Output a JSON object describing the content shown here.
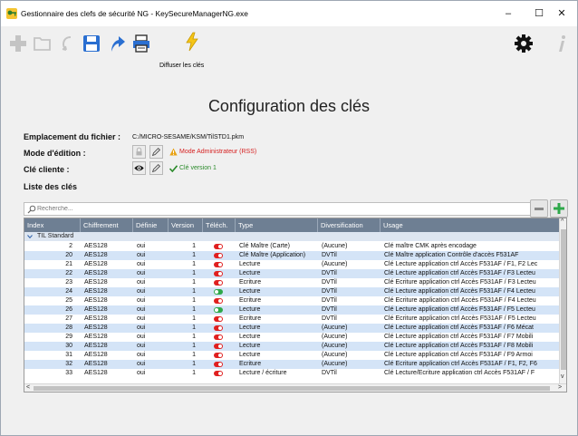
{
  "window": {
    "title": "Gestionnaire des clefs de sécurité NG - KeySecureManagerNG.exe",
    "controls": {
      "minimize": "–",
      "maximize": "☐",
      "close": "✕"
    }
  },
  "toolbar": {
    "icons": [
      "add-icon",
      "folder-open-icon",
      "undo-icon",
      "save-icon",
      "upload-icon",
      "printer-icon",
      "lightning-icon",
      "gear-icon",
      "info-icon"
    ],
    "broadcast_label": "Diffuser les clés"
  },
  "page": {
    "title": "Configuration des clés",
    "file_location_label": "Emplacement du fichier :",
    "file_location_value": "C:/MICRO-SESAME/KSM/TilSTD1.pkm",
    "edit_mode_label": "Mode d'édition :",
    "edit_mode_status": "Mode Administrateur (RSS)",
    "client_key_label": "Clé cliente :",
    "client_key_status": "Clé version 1",
    "key_list_label": "Liste des clés"
  },
  "search": {
    "placeholder": "Recherche..."
  },
  "list_buttons": {
    "remove": "−",
    "add": "+"
  },
  "colors": {
    "header_bg": "#6e7f93",
    "row_alt": "#d4e4f7",
    "toggle_off": "#e02020",
    "toggle_on": "#2ea84a",
    "warning": "#d62222",
    "ok": "#2a8a2a"
  },
  "grid": {
    "columns": [
      "Index",
      "Chiffrement",
      "Définie",
      "Version",
      "Téléch.",
      "Type",
      "Diversification",
      "Usage"
    ],
    "group": "TIL Standard",
    "rows": [
      {
        "index": "2",
        "cipher": "AES128",
        "defined": "oui",
        "version": "1",
        "download": false,
        "type": "Clé Maître (Carte)",
        "div": "(Aucune)",
        "usage": "Clé maître CMK après encodage"
      },
      {
        "index": "20",
        "cipher": "AES128",
        "defined": "oui",
        "version": "1",
        "download": false,
        "type": "Clé Maître (Application)",
        "div": "DVTil",
        "usage": "Clé Maître application Contrôle d'accès F531AF"
      },
      {
        "index": "21",
        "cipher": "AES128",
        "defined": "oui",
        "version": "1",
        "download": false,
        "type": "Lecture",
        "div": "(Aucune)",
        "usage": "Clé Lecture application ctrl Accès F531AF / F1, F2 Lec"
      },
      {
        "index": "22",
        "cipher": "AES128",
        "defined": "oui",
        "version": "1",
        "download": false,
        "type": "Lecture",
        "div": "DVTil",
        "usage": "Clé Lecture application ctrl Accès F531AF / F3 Lecteu"
      },
      {
        "index": "23",
        "cipher": "AES128",
        "defined": "oui",
        "version": "1",
        "download": false,
        "type": "Ecriture",
        "div": "DVTil",
        "usage": "Clé Ecriture application ctrl Accès F531AF / F3 Lecteu"
      },
      {
        "index": "24",
        "cipher": "AES128",
        "defined": "oui",
        "version": "1",
        "download": true,
        "type": "Lecture",
        "div": "DVTil",
        "usage": "Clé Lecture application ctrl Accès F531AF / F4 Lecteu"
      },
      {
        "index": "25",
        "cipher": "AES128",
        "defined": "oui",
        "version": "1",
        "download": false,
        "type": "Ecriture",
        "div": "DVTil",
        "usage": "Clé Ecriture application ctrl Accès F531AF / F4 Lecteu"
      },
      {
        "index": "26",
        "cipher": "AES128",
        "defined": "oui",
        "version": "1",
        "download": true,
        "type": "Lecture",
        "div": "DVTil",
        "usage": "Clé Lecture application ctrl Accès F531AF / F5 Lecteu"
      },
      {
        "index": "27",
        "cipher": "AES128",
        "defined": "oui",
        "version": "1",
        "download": false,
        "type": "Ecriture",
        "div": "DVTil",
        "usage": "Clé Ecriture application ctrl Accès F531AF / F5 Lecteu"
      },
      {
        "index": "28",
        "cipher": "AES128",
        "defined": "oui",
        "version": "1",
        "download": false,
        "type": "Lecture",
        "div": "(Aucune)",
        "usage": "Clé Lecture application ctrl Accès F531AF / F6 Mécat"
      },
      {
        "index": "29",
        "cipher": "AES128",
        "defined": "oui",
        "version": "1",
        "download": false,
        "type": "Lecture",
        "div": "(Aucune)",
        "usage": "Clé Lecture application ctrl Accès F531AF / F7 Mobili"
      },
      {
        "index": "30",
        "cipher": "AES128",
        "defined": "oui",
        "version": "1",
        "download": false,
        "type": "Lecture",
        "div": "(Aucune)",
        "usage": "Clé Lecture application ctrl Accès F531AF / F8 Mobili"
      },
      {
        "index": "31",
        "cipher": "AES128",
        "defined": "oui",
        "version": "1",
        "download": false,
        "type": "Lecture",
        "div": "(Aucune)",
        "usage": "Clé Lecture application ctrl Accès F531AF / F9 Armoi"
      },
      {
        "index": "32",
        "cipher": "AES128",
        "defined": "oui",
        "version": "1",
        "download": false,
        "type": "Ecriture",
        "div": "(Aucune)",
        "usage": "Clé Ecriture application ctrl Accès F531AF / F1, F2, F6"
      },
      {
        "index": "33",
        "cipher": "AES128",
        "defined": "oui",
        "version": "1",
        "download": false,
        "type": "Lecture / écriture",
        "div": "DVTil",
        "usage": "Clé Lecture/Ecriture application ctrl Accès F531AF / F"
      }
    ]
  }
}
